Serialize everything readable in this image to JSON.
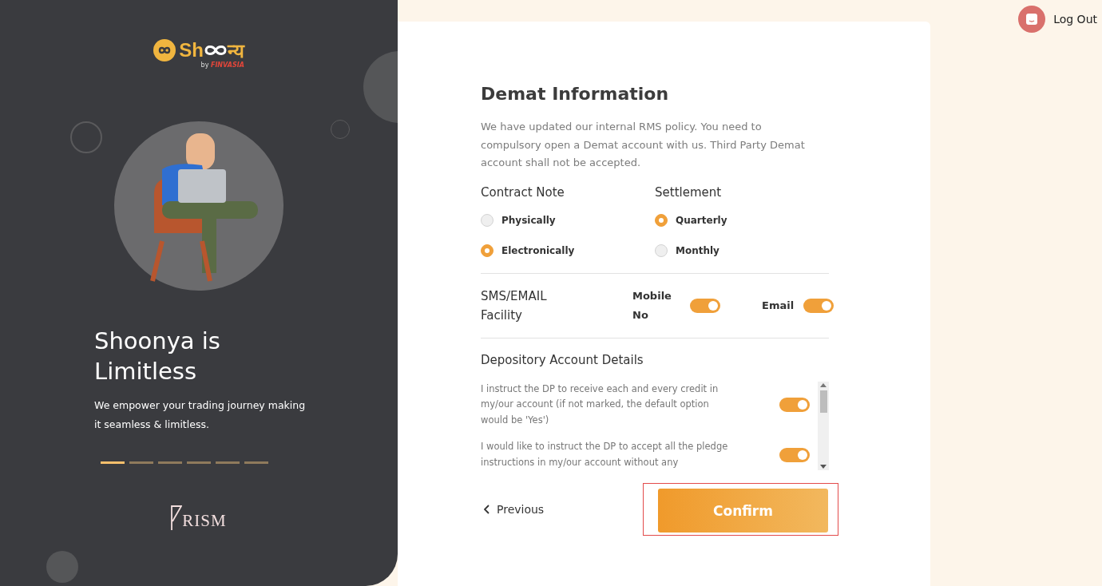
{
  "brand": {
    "name_start": "Sh",
    "name_end": "न्य",
    "by": "by",
    "company": "FINVASIA"
  },
  "hero": {
    "title": "Shoonya is Limitless",
    "subtitle": "We empower your trading journey making it seamless & limitless."
  },
  "carousel": [
    {
      "selected": true
    },
    {
      "selected": false
    },
    {
      "selected": false
    },
    {
      "selected": false
    },
    {
      "selected": false
    },
    {
      "selected": false
    }
  ],
  "footer_logo": "RISM",
  "logout": "Log Out",
  "form": {
    "title": "Demat Information",
    "description": "We have updated our internal RMS policy. You need to compulsory open a Demat account with us. Third Party Demat account shall not be accepted.",
    "groups": [
      {
        "label": "Contract Note",
        "options": [
          {
            "label": "Physically",
            "selected": false
          },
          {
            "label": "Electronically",
            "selected": true
          }
        ]
      },
      {
        "label": "Settlement",
        "options": [
          {
            "label": "Quarterly",
            "selected": true
          },
          {
            "label": "Monthly",
            "selected": false
          }
        ]
      }
    ],
    "facility": {
      "label": "SMS/EMAIL Facility",
      "toggles": [
        {
          "label": "Mobile No",
          "on": true
        },
        {
          "label": "Email",
          "on": true
        }
      ]
    },
    "depository": {
      "title": "Depository Account Details",
      "items": [
        {
          "text": "I instruct the DP to receive each and every credit in my/our account (if not marked, the default option would be 'Yes')",
          "on": true
        },
        {
          "text": "I would like to instruct the DP to accept all the pledge instructions in my/our account without any",
          "on": true
        }
      ]
    },
    "previous": "Previous",
    "confirm": "Confirm"
  }
}
